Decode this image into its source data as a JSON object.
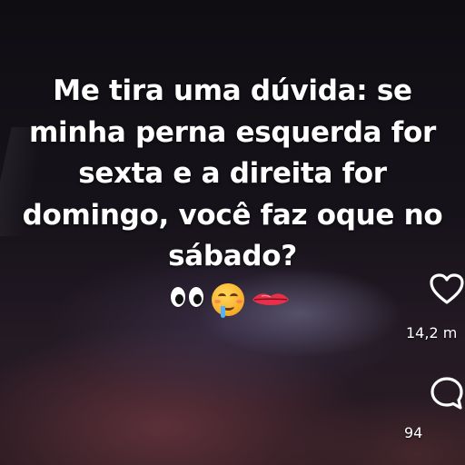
{
  "caption": {
    "lines": [
      "Me tira uma dúvida: se",
      "minha perna esquerda for",
      "sexta e a direita for",
      "domingo, você faz oque no",
      "sábado?"
    ],
    "emoji_icons": [
      "eyes-emoji",
      "drooling-face-emoji",
      "lips-emoji"
    ]
  },
  "actions": {
    "like": {
      "icon": "heart-icon",
      "count": "14,2 m"
    },
    "comment": {
      "icon": "comment-bubble-icon",
      "count": "94"
    }
  },
  "colors": {
    "text": "#ffffff",
    "background": "#120f15"
  }
}
